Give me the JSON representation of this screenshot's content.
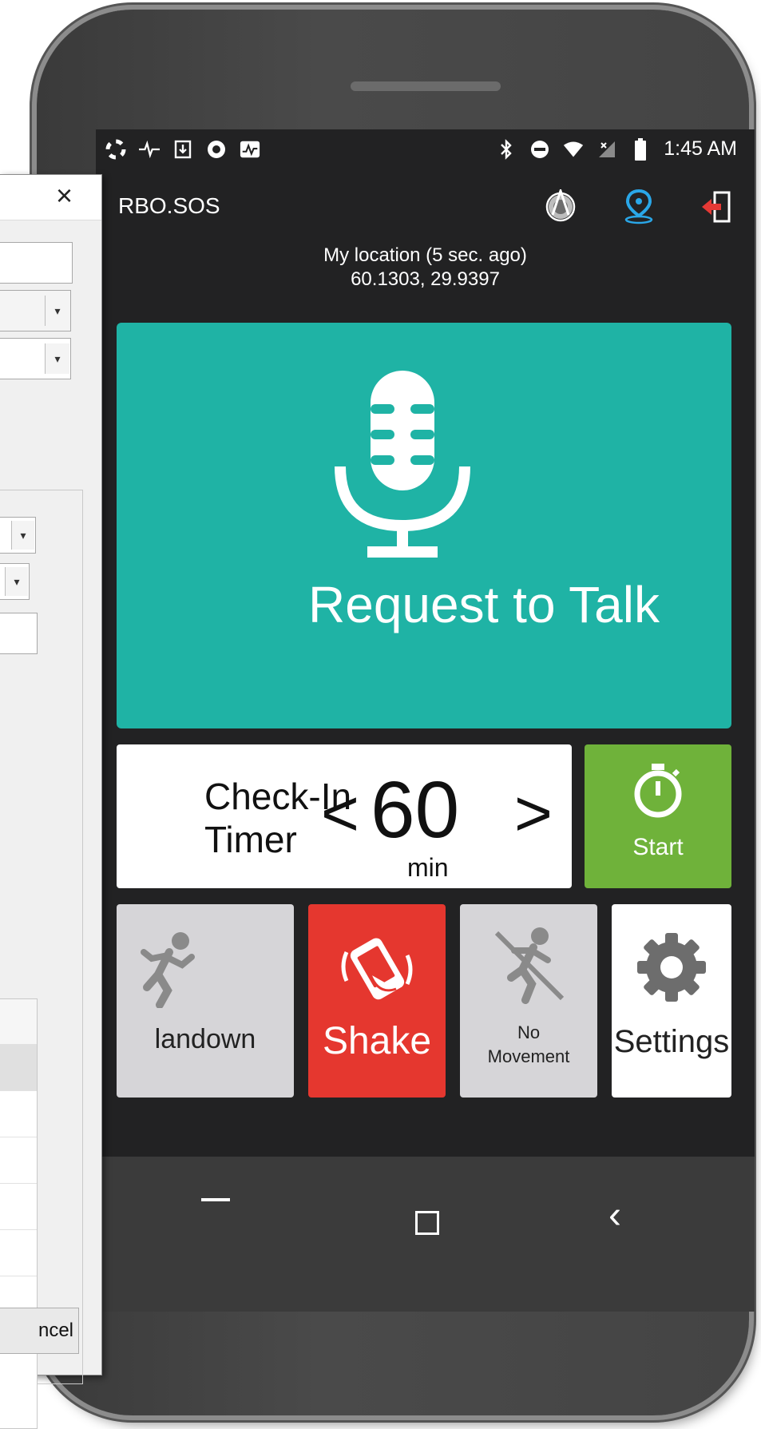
{
  "status_bar": {
    "time": "1:45 AM",
    "left_icons": [
      "lifebuoy-icon",
      "pulse-icon",
      "download-icon",
      "record-icon",
      "activity-icon"
    ],
    "right_icons": [
      "bluetooth-icon",
      "do-not-disturb-icon",
      "wifi-icon",
      "no-signal-icon",
      "battery-icon"
    ]
  },
  "app_bar": {
    "title": "RBO.SOS",
    "icons": [
      "gps-satellite-icon",
      "location-pin-icon",
      "logout-icon"
    ]
  },
  "location": {
    "line1": "My location (5 sec. ago)",
    "line2": "60.1303, 29.9397"
  },
  "request_talk": {
    "label": "Request to Talk",
    "color": "#1fb3a5"
  },
  "checkin_timer": {
    "label_line1": "Check-In",
    "label_line2": "Timer",
    "decrement": "<",
    "value": "60",
    "increment": ">",
    "unit": "min"
  },
  "start_button": {
    "label": "Start",
    "color": "#6fb23a"
  },
  "tiles": {
    "mandown": "landown",
    "shake": "Shake",
    "no_movement_line1": "No",
    "no_movement_line2": "Movement",
    "settings": "Settings"
  },
  "colors": {
    "shake": "#e5372f",
    "gray_tile": "#d6d5d8",
    "logout": "#e53935",
    "pin": "#2aa7e8"
  },
  "dialog": {
    "close": "×",
    "cancel_label": "ncel"
  }
}
